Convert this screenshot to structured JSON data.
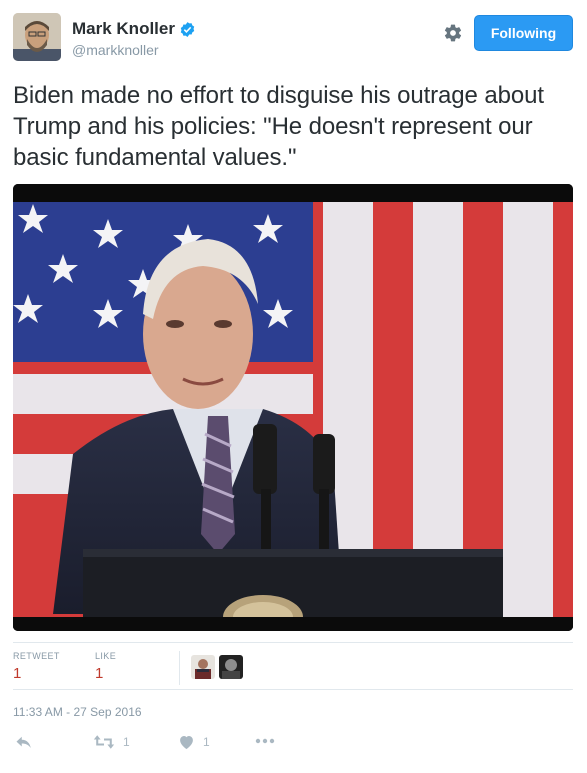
{
  "user": {
    "name": "Mark Knoller",
    "handle": "@markknoller",
    "verified": true
  },
  "follow_button": {
    "label": "Following",
    "color": "#2b9af3"
  },
  "tweet": {
    "text": "Biden made no effort to disguise his outrage about Trump and his policies: \"He doesn't represent our basic fundamental values.\""
  },
  "stats": {
    "retweets": {
      "label": "RETWEET",
      "value": "1"
    },
    "likes": {
      "label": "LIKE",
      "value": "1"
    }
  },
  "timestamp": "11:33 AM - 27 Sep 2016",
  "actions": {
    "reply": {
      "icon": "reply-icon"
    },
    "retweet": {
      "icon": "retweet-icon",
      "count": "1"
    },
    "like": {
      "icon": "heart-icon",
      "count": "1"
    },
    "more": {
      "icon": "more-icon"
    }
  },
  "colors": {
    "count_red": "#c0392b",
    "muted": "#8899a6",
    "border": "#e1e8ed"
  }
}
